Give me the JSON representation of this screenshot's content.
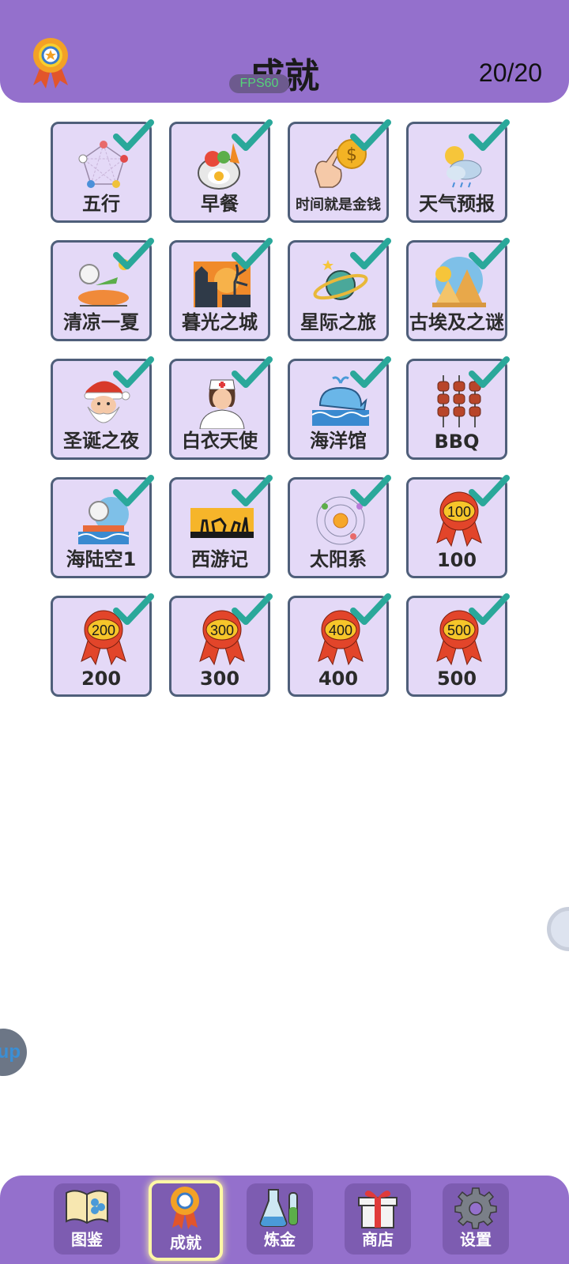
{
  "header": {
    "title": "成就",
    "counter": "20/20",
    "fps": "FPS60"
  },
  "achievements": [
    {
      "label": "五行",
      "icon": "five-elements-icon"
    },
    {
      "label": "早餐",
      "icon": "breakfast-icon"
    },
    {
      "label": "时间就是金钱",
      "icon": "time-is-money-icon"
    },
    {
      "label": "天气预报",
      "icon": "weather-icon"
    },
    {
      "label": "清凉一夏",
      "icon": "cool-summer-icon"
    },
    {
      "label": "暮光之城",
      "icon": "twilight-city-icon"
    },
    {
      "label": "星际之旅",
      "icon": "planet-icon"
    },
    {
      "label": "古埃及之谜",
      "icon": "pyramid-icon"
    },
    {
      "label": "圣诞之夜",
      "icon": "santa-icon"
    },
    {
      "label": "白衣天使",
      "icon": "nurse-icon"
    },
    {
      "label": "海洋馆",
      "icon": "whale-icon"
    },
    {
      "label": "BBQ",
      "icon": "bbq-skewer-icon"
    },
    {
      "label": "海陆空1",
      "icon": "sea-land-air-icon"
    },
    {
      "label": "西游记",
      "icon": "journey-west-icon"
    },
    {
      "label": "太阳系",
      "icon": "solar-system-icon"
    },
    {
      "label": "100",
      "icon": "ribbon-medal-icon",
      "badge": "100"
    },
    {
      "label": "200",
      "icon": "ribbon-medal-icon",
      "badge": "200"
    },
    {
      "label": "300",
      "icon": "ribbon-medal-icon",
      "badge": "300"
    },
    {
      "label": "400",
      "icon": "ribbon-medal-icon",
      "badge": "400"
    },
    {
      "label": "500",
      "icon": "ribbon-medal-icon",
      "badge": "500"
    }
  ],
  "side": {
    "left_label": "up"
  },
  "tabs": [
    {
      "label": "图鉴",
      "icon": "book-icon",
      "active": false
    },
    {
      "label": "成就",
      "icon": "medal-icon",
      "active": true
    },
    {
      "label": "炼金",
      "icon": "flask-icon",
      "active": false
    },
    {
      "label": "商店",
      "icon": "gift-icon",
      "active": false
    },
    {
      "label": "设置",
      "icon": "gear-icon",
      "active": false
    }
  ],
  "colors": {
    "header": "#9470cc",
    "card_bg": "#e4d9f7",
    "card_border": "#4f5f7a",
    "check": "#2aa89a"
  }
}
